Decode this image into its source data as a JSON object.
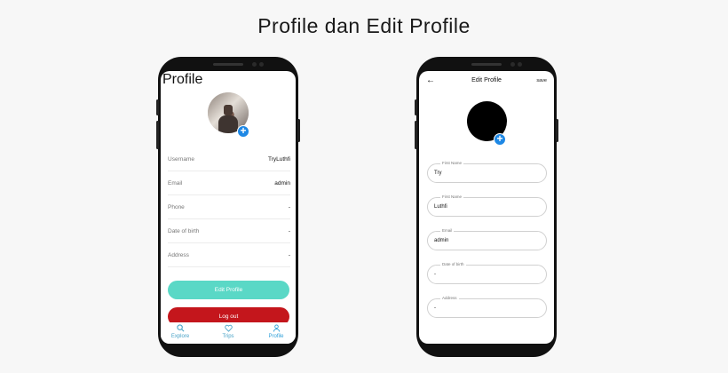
{
  "title": "Profile dan Edit Profile",
  "profile": {
    "header": "Profile",
    "rows": [
      {
        "label": "Username",
        "value": "TryLuthfi"
      },
      {
        "label": "Email",
        "value": "admin"
      },
      {
        "label": "Phone",
        "value": "-"
      },
      {
        "label": "Date of birth",
        "value": "-"
      },
      {
        "label": "Address",
        "value": "-"
      }
    ],
    "edit_button": "Edit Profile",
    "logout_button": "Log out",
    "tabs": [
      {
        "label": "Explore",
        "icon": "search-icon"
      },
      {
        "label": "Trips",
        "icon": "heart-icon"
      },
      {
        "label": "Profile",
        "icon": "user-icon"
      }
    ],
    "colors": {
      "edit": "#5ad8c6",
      "logout": "#c4161c",
      "tab": "#2f9fd8"
    }
  },
  "edit_profile": {
    "back": "←",
    "title": "Edit Profile",
    "save": "save",
    "fields": [
      {
        "label": "First Name",
        "value": "Try"
      },
      {
        "label": "First Name",
        "value": "Luthfi"
      },
      {
        "label": "Email",
        "value": "admin"
      },
      {
        "label": "Date of birth",
        "value": "-"
      },
      {
        "label": "Address",
        "value": "-"
      }
    ]
  },
  "plus": "+"
}
